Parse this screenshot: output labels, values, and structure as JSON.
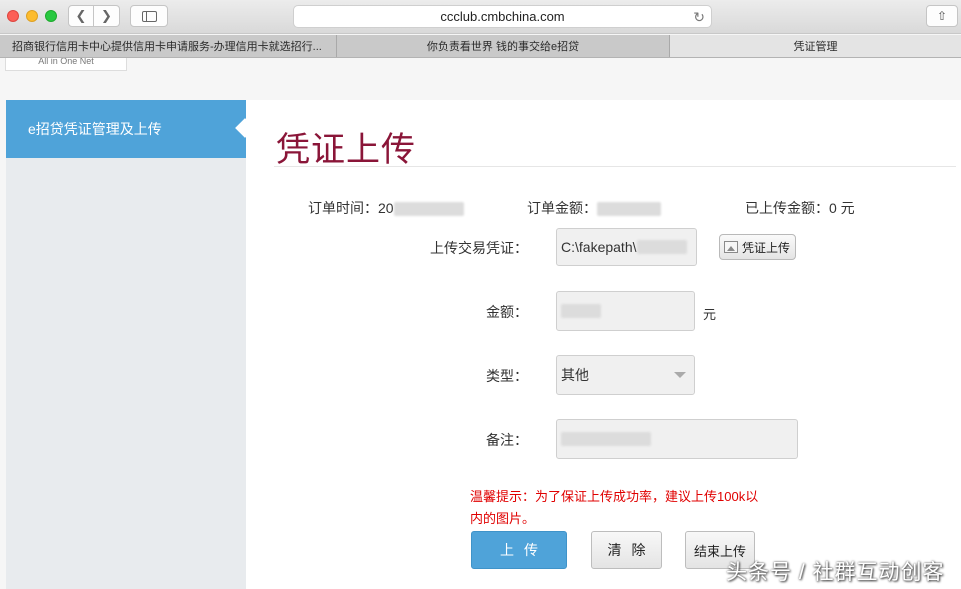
{
  "browser": {
    "url": "ccclub.cmbchina.com",
    "tabs": [
      "招商银行信用卡中心提供信用卡申请服务-办理信用卡就选招行...",
      "你负责看世界 钱的事交给e招贷",
      "凭证管理"
    ]
  },
  "header": {
    "logo_text": "All in One Net"
  },
  "sidebar": {
    "active_item": "e招贷凭证管理及上传"
  },
  "main": {
    "title": "凭证上传",
    "order_time_label": "订单时间：",
    "order_time_value": "20",
    "order_amount_label": "订单金额：",
    "uploaded_amount_label": "已上传金额：",
    "uploaded_amount_value": "0 元",
    "form": {
      "voucher_label": "上传交易凭证：",
      "voucher_value": "C:\\fakepath\\",
      "voucher_button": "凭证上传",
      "amount_label": "金额：",
      "amount_unit": "元",
      "type_label": "类型：",
      "type_value": "其他",
      "note_label": "备注："
    },
    "tip": "温馨提示：为了保证上传成功率，建议上传100k以内的图片。",
    "buttons": {
      "submit": "上传",
      "clear": "清除",
      "finish": "结束上传"
    }
  },
  "watermark": "头条号 / 社群互动创客",
  "colors": {
    "accent": "#4fa3d9",
    "title": "#8a1538",
    "tip": "#e00000"
  }
}
